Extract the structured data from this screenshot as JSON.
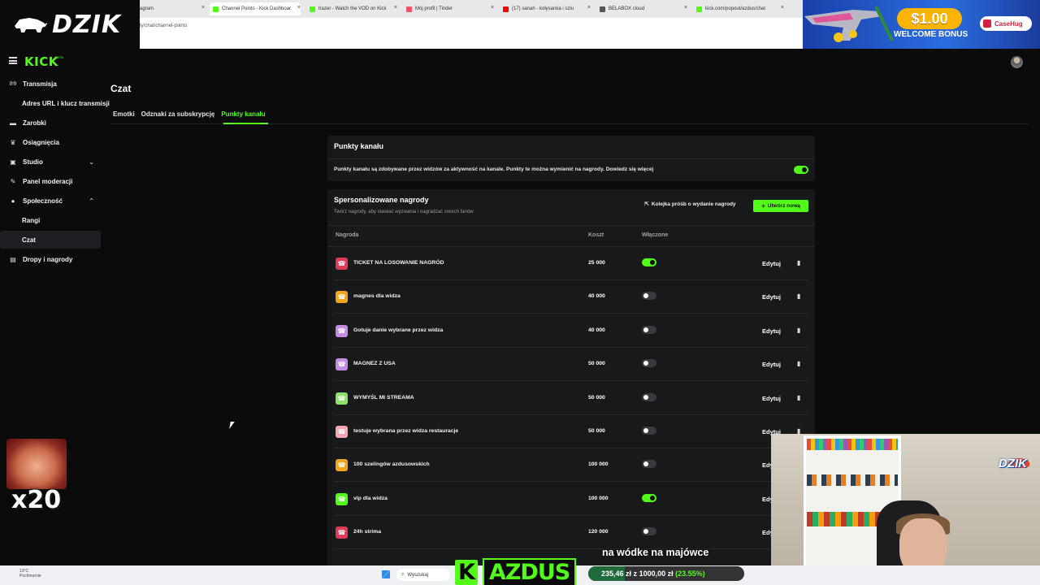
{
  "browser": {
    "tabs": [
      {
        "label": "agram",
        "favicon_color": "#e1306c",
        "active": false
      },
      {
        "label": "Channel Points - Kick Dashboar",
        "favicon_color": "#53fc18",
        "active": true
      },
      {
        "label": "trazer - Watch the VOD on Kick",
        "favicon_color": "#53fc18",
        "active": false
      },
      {
        "label": "Mój profil | Tinder",
        "favicon_color": "#fd5068",
        "active": false
      },
      {
        "label": "(17) sanah - kołysanka i szlu",
        "favicon_color": "#ff0000",
        "active": false
      },
      {
        "label": "BELABOX cloud",
        "favicon_color": "#555555",
        "active": false
      },
      {
        "label": "kick.com/popout/azdus/chat",
        "favicon_color": "#53fc18",
        "active": false
      }
    ],
    "url": "ty/chat/channel-points"
  },
  "overlay": {
    "logo_text": "DZIK",
    "ad": {
      "amount": "$1.00",
      "bonus": "WELCOME BONUS",
      "brand": "CaseHug"
    },
    "emote_multiplier": "x20",
    "webcam_brand": "DZIK",
    "caption": "na wódke na majówce",
    "channel_logo": "AZDUS",
    "channel_logo_k": "K",
    "goal": {
      "current": "235,46 zł",
      "separator": "z",
      "target": "1000,00 zł",
      "percent": "(23.55%)",
      "progress": 0.2355
    }
  },
  "taskbar": {
    "weather_temp": "13°C",
    "weather_desc": "Pochmurnie",
    "search_placeholder": "Wyszukaj"
  },
  "kick": {
    "logo": "KICK",
    "beta": "BETA",
    "sidebar": [
      {
        "label": "Transmisja",
        "icon": "broadcast-icon",
        "glyph": "((•))",
        "sub": false
      },
      {
        "label": "Adres URL i klucz transmisji",
        "sub": true
      },
      {
        "label": "Zarobki",
        "icon": "wallet-icon",
        "glyph": "▬",
        "sub": false
      },
      {
        "label": "Osiągnięcia",
        "icon": "trophy-icon",
        "glyph": "♛",
        "sub": false
      },
      {
        "label": "Studio",
        "icon": "studio-icon",
        "glyph": "▣",
        "sub": false,
        "chevron": "⌄"
      },
      {
        "label": "Panel moderacji",
        "icon": "wrench-icon",
        "glyph": "✎",
        "sub": false
      },
      {
        "label": "Społeczność",
        "icon": "community-icon",
        "glyph": "●",
        "sub": false,
        "chevron": "⌃"
      },
      {
        "label": "Rangi",
        "sub": true
      },
      {
        "label": "Czat",
        "sub": true,
        "active": true
      },
      {
        "label": "Dropy i nagrody",
        "icon": "gift-icon",
        "glyph": "▤",
        "sub": false
      }
    ],
    "page_title": "Czat",
    "tabs": [
      "Emotki",
      "Odznaki za subskrypcję",
      "Punkty kanału"
    ],
    "active_tab": 2,
    "points_card": {
      "title": "Punkty kanału",
      "description": "Punkty kanału są zdobywane przez widzów za aktywność na kanale. Punkty te można wymienić na nagrody. Dowiedz się więcej",
      "enabled": true
    },
    "rewards_card": {
      "title": "Spersonalizowane nagrody",
      "subtitle": "Twórz nagrody, aby stawiać wyzwania i nagradzać swoich fanów",
      "queue_label": "Kolejka próśb o wydanie nagrody",
      "create_label": "Utwórz nową",
      "columns": {
        "reward": "Nagroda",
        "cost": "Koszt",
        "enabled": "Włączone"
      },
      "edit_label": "Edytuj",
      "rows": [
        {
          "name": "TICKET NA LOSOWANIE NAGRÓD",
          "cost": "25 000",
          "enabled": true,
          "color": "#e03a5a"
        },
        {
          "name": "magnes dla widza",
          "cost": "40 000",
          "enabled": false,
          "color": "#f2a31b"
        },
        {
          "name": "Gotuje danie wybrane przez widza",
          "cost": "40 000",
          "enabled": false,
          "color": "#c58ce6"
        },
        {
          "name": "MAGNEZ Z USA",
          "cost": "50 000",
          "enabled": false,
          "color": "#c58ce6"
        },
        {
          "name": "WYMYŚL MI STREAMA",
          "cost": "50 000",
          "enabled": false,
          "color": "#8ee06a"
        },
        {
          "name": "testuje wybrana przez widza restauracje",
          "cost": "50 000",
          "enabled": false,
          "color": "#f4a6b5"
        },
        {
          "name": "100 szelingów azdusowskich",
          "cost": "100 000",
          "enabled": false,
          "color": "#f2a31b"
        },
        {
          "name": "vip dla widza",
          "cost": "100 000",
          "enabled": true,
          "color": "#53fc18"
        },
        {
          "name": "24h strima",
          "cost": "120 000",
          "enabled": false,
          "color": "#e03a5a"
        }
      ]
    }
  }
}
